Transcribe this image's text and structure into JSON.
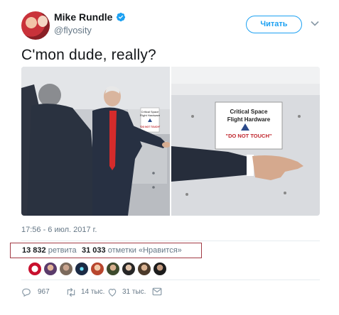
{
  "user": {
    "name": "Mike Rundle",
    "handle": "@flyosity"
  },
  "follow_label": "Читать",
  "tweet_text": "C'mon dude, really?",
  "sign": {
    "line1": "Critical Space",
    "line2": "Flight Hardware",
    "warning": "\"DO NOT TOUCH\""
  },
  "timestamp": "17:56 - 6 июл. 2017 г.",
  "stats": {
    "retweets_count": "13 832",
    "retweets_label": "ретвита",
    "likes_count": "31 033",
    "likes_label": "отметки «Нравится»"
  },
  "actions": {
    "replies": "967",
    "retweets": "14 тыс.",
    "likes": "31 тыс."
  },
  "colors": {
    "accent": "#1da1f2",
    "highlight_box": "#a23b45",
    "muted": "#657786"
  }
}
